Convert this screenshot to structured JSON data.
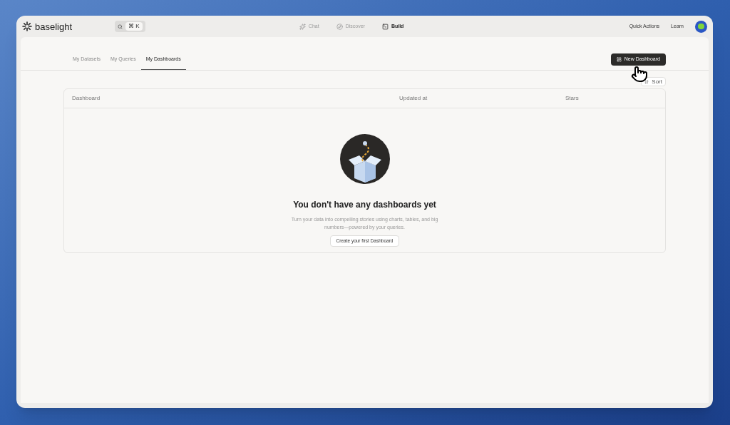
{
  "logo": {
    "name": "baselight"
  },
  "search": {
    "shortcut": "⌘ K"
  },
  "nav": [
    {
      "label": "Chat",
      "selected": false
    },
    {
      "label": "Discover",
      "selected": false
    },
    {
      "label": "Build",
      "selected": true
    }
  ],
  "header_links": [
    "Quick Actions",
    "Learn"
  ],
  "tabs": [
    {
      "label": "My Datasets",
      "selected": false
    },
    {
      "label": "My Queries",
      "selected": false
    },
    {
      "label": "My Dashboards",
      "selected": true
    }
  ],
  "new_button": "New Dashboard",
  "sort_button": "Sort",
  "table": {
    "columns": [
      "Dashboard",
      "Updated at",
      "Stars"
    ]
  },
  "empty_state": {
    "title": "You don't have any dashboards yet",
    "text": "Turn your data into compelling stories using charts, tables, and big numbers—powered by your queries.",
    "button": "Create your first Dashboard"
  }
}
